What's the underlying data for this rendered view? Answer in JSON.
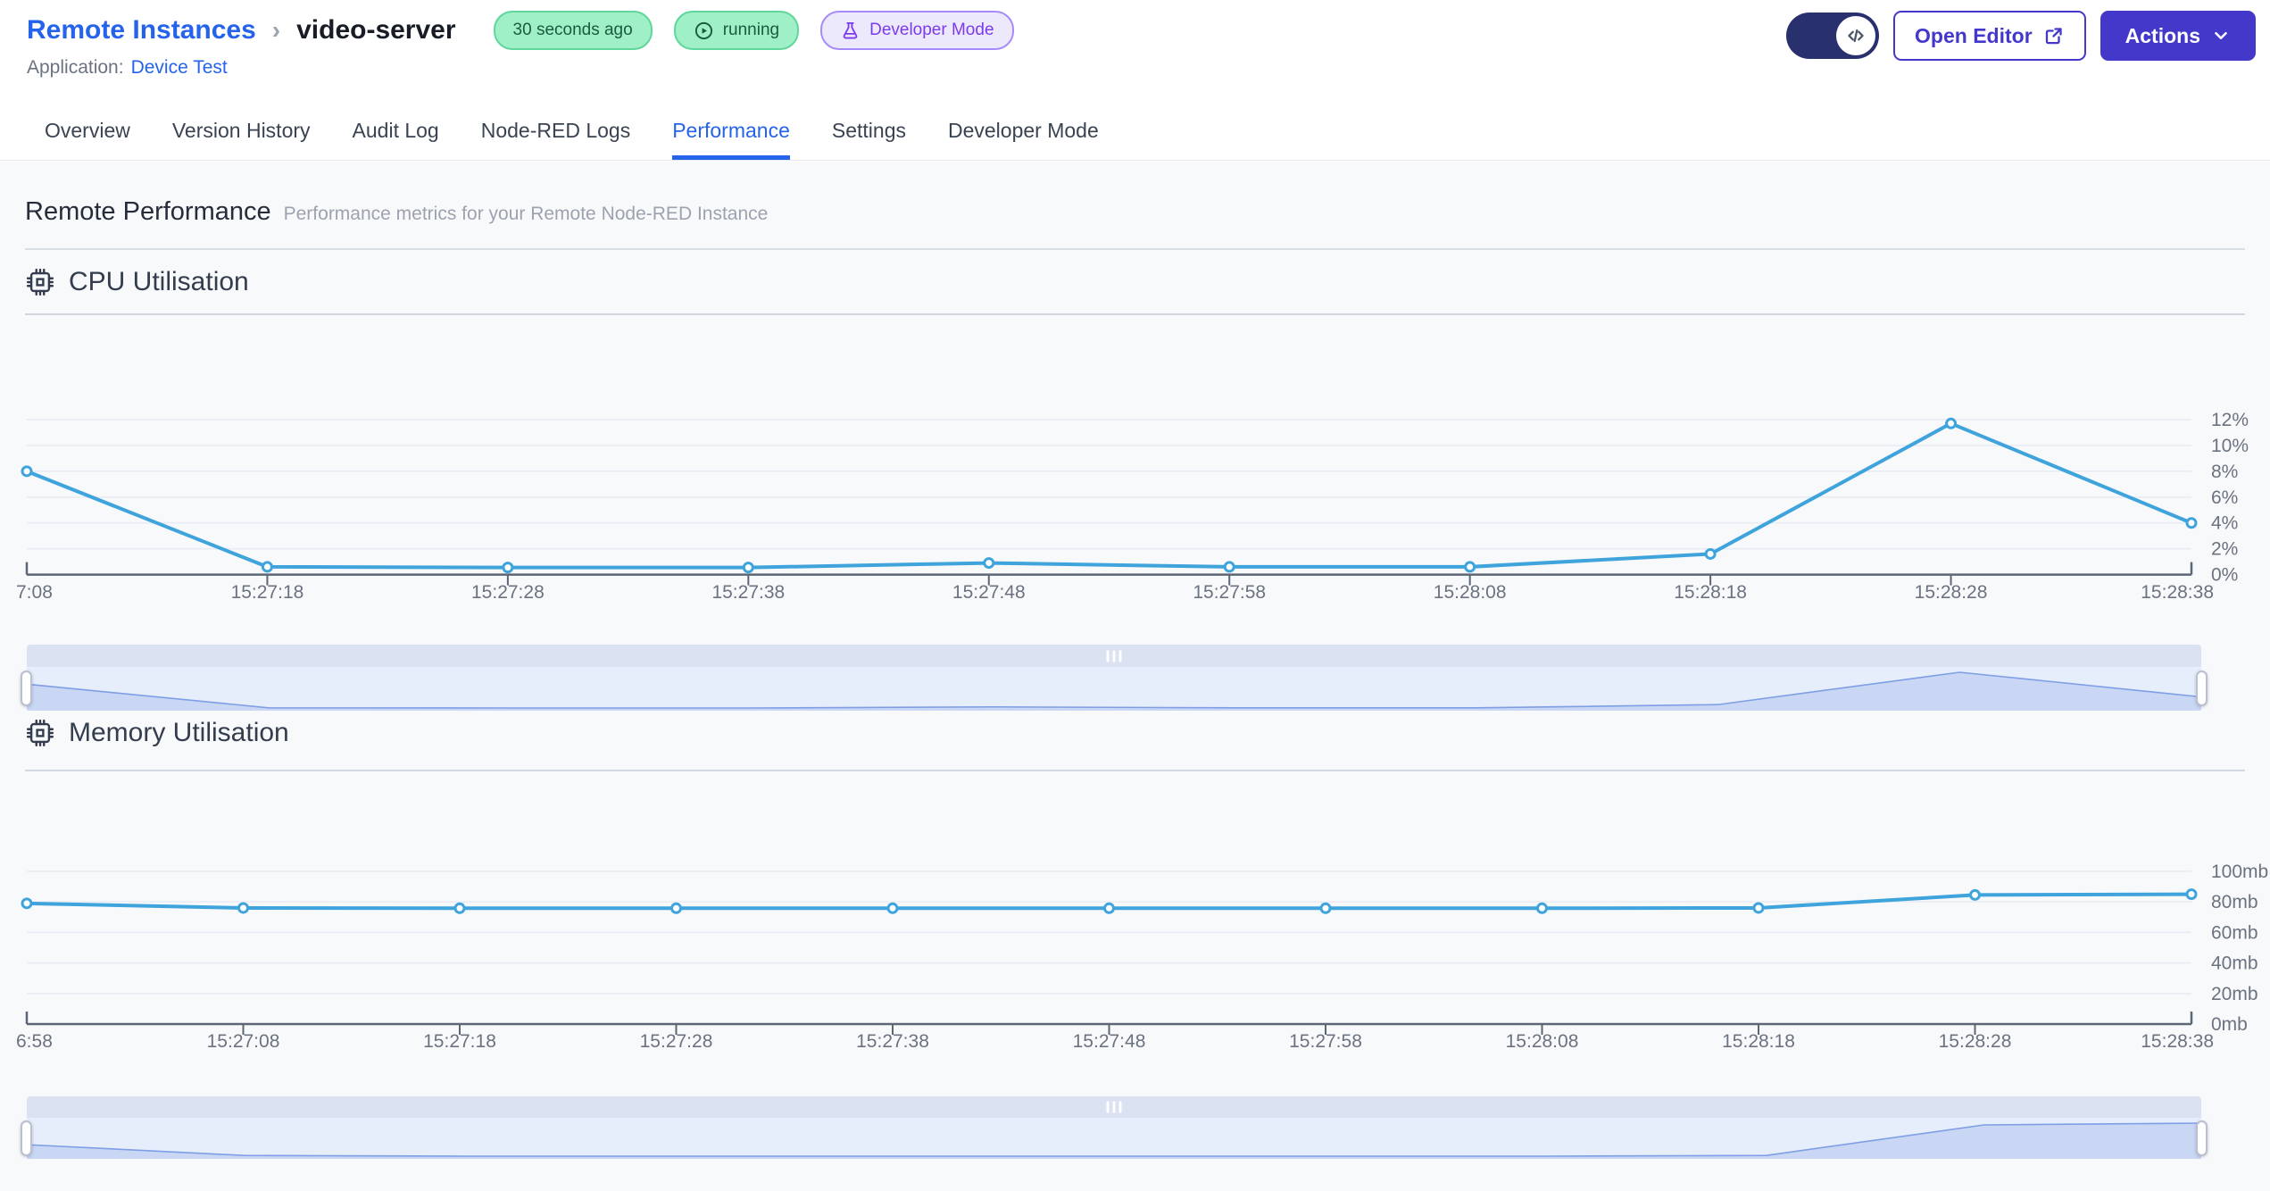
{
  "header": {
    "breadcrumb": {
      "root": "Remote Instances",
      "separator": "›",
      "current": "video-server"
    },
    "badges": {
      "last_seen": "30 seconds ago",
      "status": "running",
      "mode": "Developer Mode"
    },
    "application_label": "Application:",
    "application_name": "Device Test",
    "open_editor_label": "Open Editor",
    "actions_label": "Actions"
  },
  "tabs": [
    {
      "label": "Overview",
      "active": false
    },
    {
      "label": "Version History",
      "active": false
    },
    {
      "label": "Audit Log",
      "active": false
    },
    {
      "label": "Node-RED Logs",
      "active": false
    },
    {
      "label": "Performance",
      "active": true
    },
    {
      "label": "Settings",
      "active": false
    },
    {
      "label": "Developer Mode",
      "active": false
    }
  ],
  "page": {
    "title": "Remote Performance",
    "subtitle": "Performance metrics for your Remote Node-RED Instance"
  },
  "sections": {
    "cpu_title": "CPU Utilisation",
    "memory_title": "Memory Utilisation"
  },
  "colors": {
    "accent_blue": "#2563EB",
    "indigo": "#4338CA",
    "toggle_navy": "#28306D",
    "badge_green_bg": "#9FEFC7",
    "badge_purple_bg": "#EDE9FD",
    "chart_line": "#3FA3DC",
    "grid_line": "#E8ECF4",
    "axis_line": "#5D6675",
    "axis_text": "#6B7280",
    "nav_fill": "#C9D7F5",
    "nav_stroke": "#7E9FE5"
  },
  "chart_data": [
    {
      "type": "line",
      "title": "CPU Utilisation",
      "categories": [
        "7:08",
        "15:27:18",
        "15:27:28",
        "15:27:38",
        "15:27:48",
        "15:27:58",
        "15:28:08",
        "15:28:18",
        "15:28:28",
        "15:28:38"
      ],
      "values": [
        8.0,
        0.6,
        0.55,
        0.55,
        0.9,
        0.6,
        0.6,
        1.6,
        11.7,
        4.0
      ],
      "ylim": [
        0,
        12
      ],
      "yticks": [
        {
          "value": 0,
          "label": "0%"
        },
        {
          "value": 2,
          "label": "2%"
        },
        {
          "value": 4,
          "label": "4%"
        },
        {
          "value": 6,
          "label": "6%"
        },
        {
          "value": 8,
          "label": "8%"
        },
        {
          "value": 10,
          "label": "10%"
        },
        {
          "value": 12,
          "label": "12%"
        }
      ],
      "ylabel_side": "right",
      "grid": true,
      "navigator": true
    },
    {
      "type": "line",
      "title": "Memory Utilisation",
      "categories": [
        "6:58",
        "15:27:08",
        "15:27:18",
        "15:27:28",
        "15:27:38",
        "15:27:48",
        "15:27:58",
        "15:28:08",
        "15:28:18",
        "15:28:28",
        "15:28:38"
      ],
      "values": [
        79,
        76,
        75.8,
        75.8,
        75.8,
        75.8,
        75.8,
        75.8,
        76,
        84.5,
        85
      ],
      "ylim": [
        0,
        100
      ],
      "yticks": [
        {
          "value": 0,
          "label": "0mb"
        },
        {
          "value": 20,
          "label": "20mb"
        },
        {
          "value": 40,
          "label": "40mb"
        },
        {
          "value": 60,
          "label": "60mb"
        },
        {
          "value": 80,
          "label": "80mb"
        },
        {
          "value": 100,
          "label": "100mb"
        }
      ],
      "ylabel_side": "right",
      "grid": true,
      "navigator": true
    }
  ]
}
